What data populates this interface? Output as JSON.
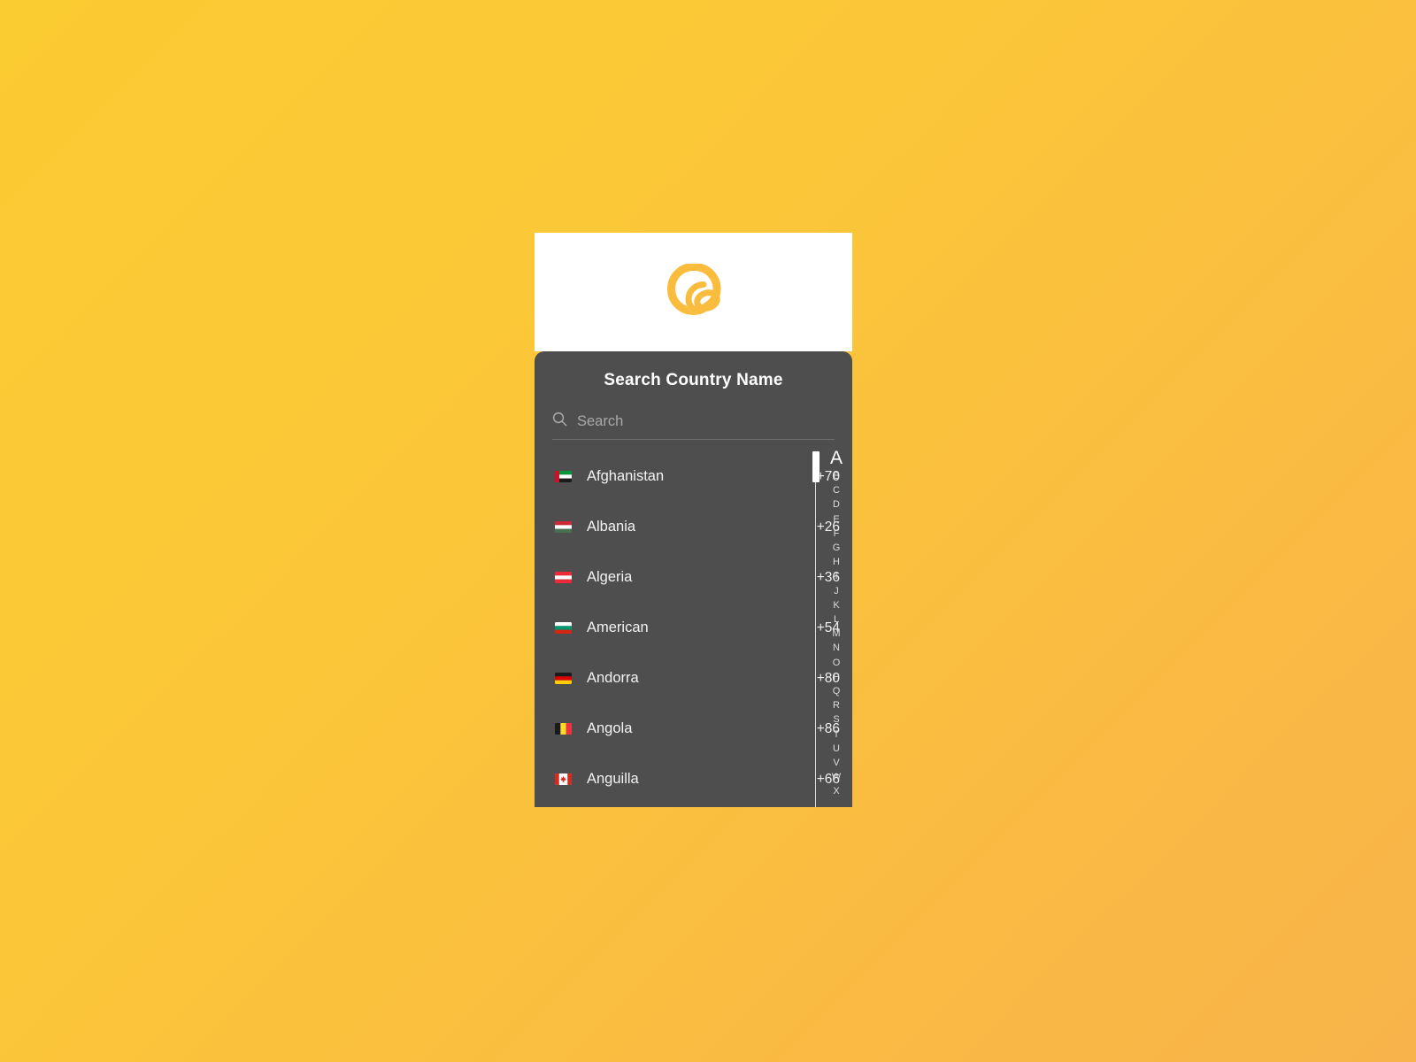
{
  "background": {
    "gradient_from": "#FBCB32",
    "gradient_to": "#F8B44A"
  },
  "card": {
    "header": {
      "logo_icon": "brand-swirl-logo",
      "logo_color": "#F9BC3C",
      "background": "#FFFFFF"
    },
    "panel": {
      "background": "#4E4E4E",
      "title": "Search Country Name"
    },
    "search": {
      "icon": "search-icon",
      "value": "",
      "placeholder": "Search"
    },
    "countries": [
      {
        "name": "Afghanistan",
        "dial_code": "+70",
        "flag": "flag-uae"
      },
      {
        "name": "Albania",
        "dial_code": "+26",
        "flag": "flag-hungary"
      },
      {
        "name": "Algeria",
        "dial_code": "+36",
        "flag": "flag-austria"
      },
      {
        "name": "American",
        "dial_code": "+54",
        "flag": "flag-bulgaria"
      },
      {
        "name": "Andorra",
        "dial_code": "+80",
        "flag": "flag-germany"
      },
      {
        "name": "Angola",
        "dial_code": "+86",
        "flag": "flag-belgium"
      },
      {
        "name": "Anguilla",
        "dial_code": "+66",
        "flag": "flag-canada"
      }
    ],
    "alphabet_index": {
      "active": "A",
      "letters": [
        "A",
        "B",
        "C",
        "D",
        "E",
        "F",
        "G",
        "H",
        "I",
        "J",
        "K",
        "L",
        "M",
        "N",
        "O",
        "P",
        "Q",
        "R",
        "S",
        "T",
        "U",
        "V",
        "W",
        "X"
      ]
    },
    "scrollbar": {
      "position_percent": 0,
      "thumb_size_percent": 9
    }
  }
}
